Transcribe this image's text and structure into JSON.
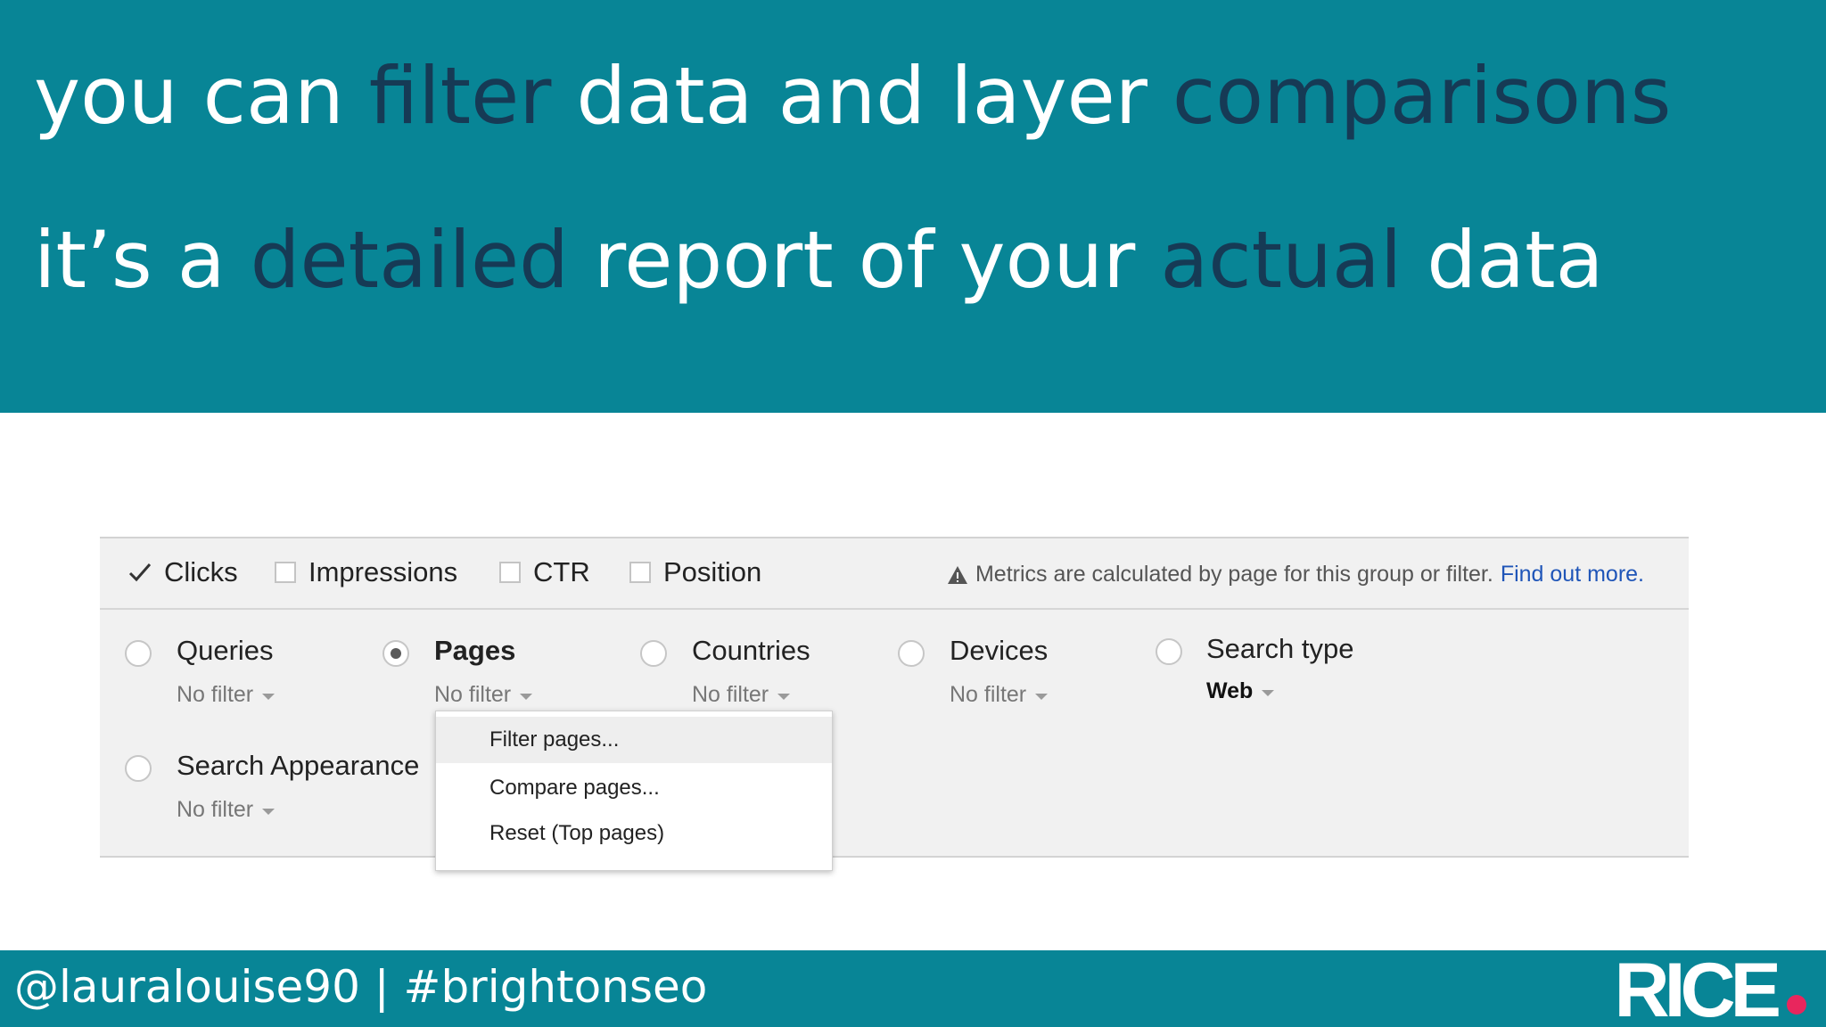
{
  "slide": {
    "line1": [
      {
        "text": "you can ",
        "highlight": false
      },
      {
        "text": "filter",
        "highlight": true
      },
      {
        "text": " data and layer ",
        "highlight": false
      },
      {
        "text": "comparisons",
        "highlight": true
      }
    ],
    "line2": [
      {
        "text": "it’s a ",
        "highlight": false
      },
      {
        "text": "detailed",
        "highlight": true
      },
      {
        "text": " report of your ",
        "highlight": false
      },
      {
        "text": "actual",
        "highlight": true
      },
      {
        "text": " data",
        "highlight": false
      }
    ],
    "colors": {
      "banner": "#088596",
      "highlight": "#163a55",
      "link": "#1f55b8",
      "logo_dot": "#e8265d"
    }
  },
  "metrics": {
    "clicks": "Clicks",
    "impressions": "Impressions",
    "ctr": "CTR",
    "position": "Position",
    "notice": "Metrics are calculated by page for this group or filter.",
    "notice_link": "Find out more."
  },
  "dimensions": {
    "queries": {
      "label": "Queries",
      "filter": "No filter"
    },
    "pages": {
      "label": "Pages",
      "filter": "No filter"
    },
    "countries": {
      "label": "Countries",
      "filter": "No filter"
    },
    "devices": {
      "label": "Devices",
      "filter": "No filter"
    },
    "search_type": {
      "label": "Search type",
      "filter": "Web"
    },
    "search_appearance": {
      "label": "Search Appearance",
      "filter": "No filter"
    }
  },
  "menu": {
    "items": [
      "Filter pages...",
      "Compare pages...",
      "Reset (Top pages)"
    ]
  },
  "footer": {
    "handle": "@lauralouise90 | #brightonseo",
    "logo": "RICE"
  }
}
